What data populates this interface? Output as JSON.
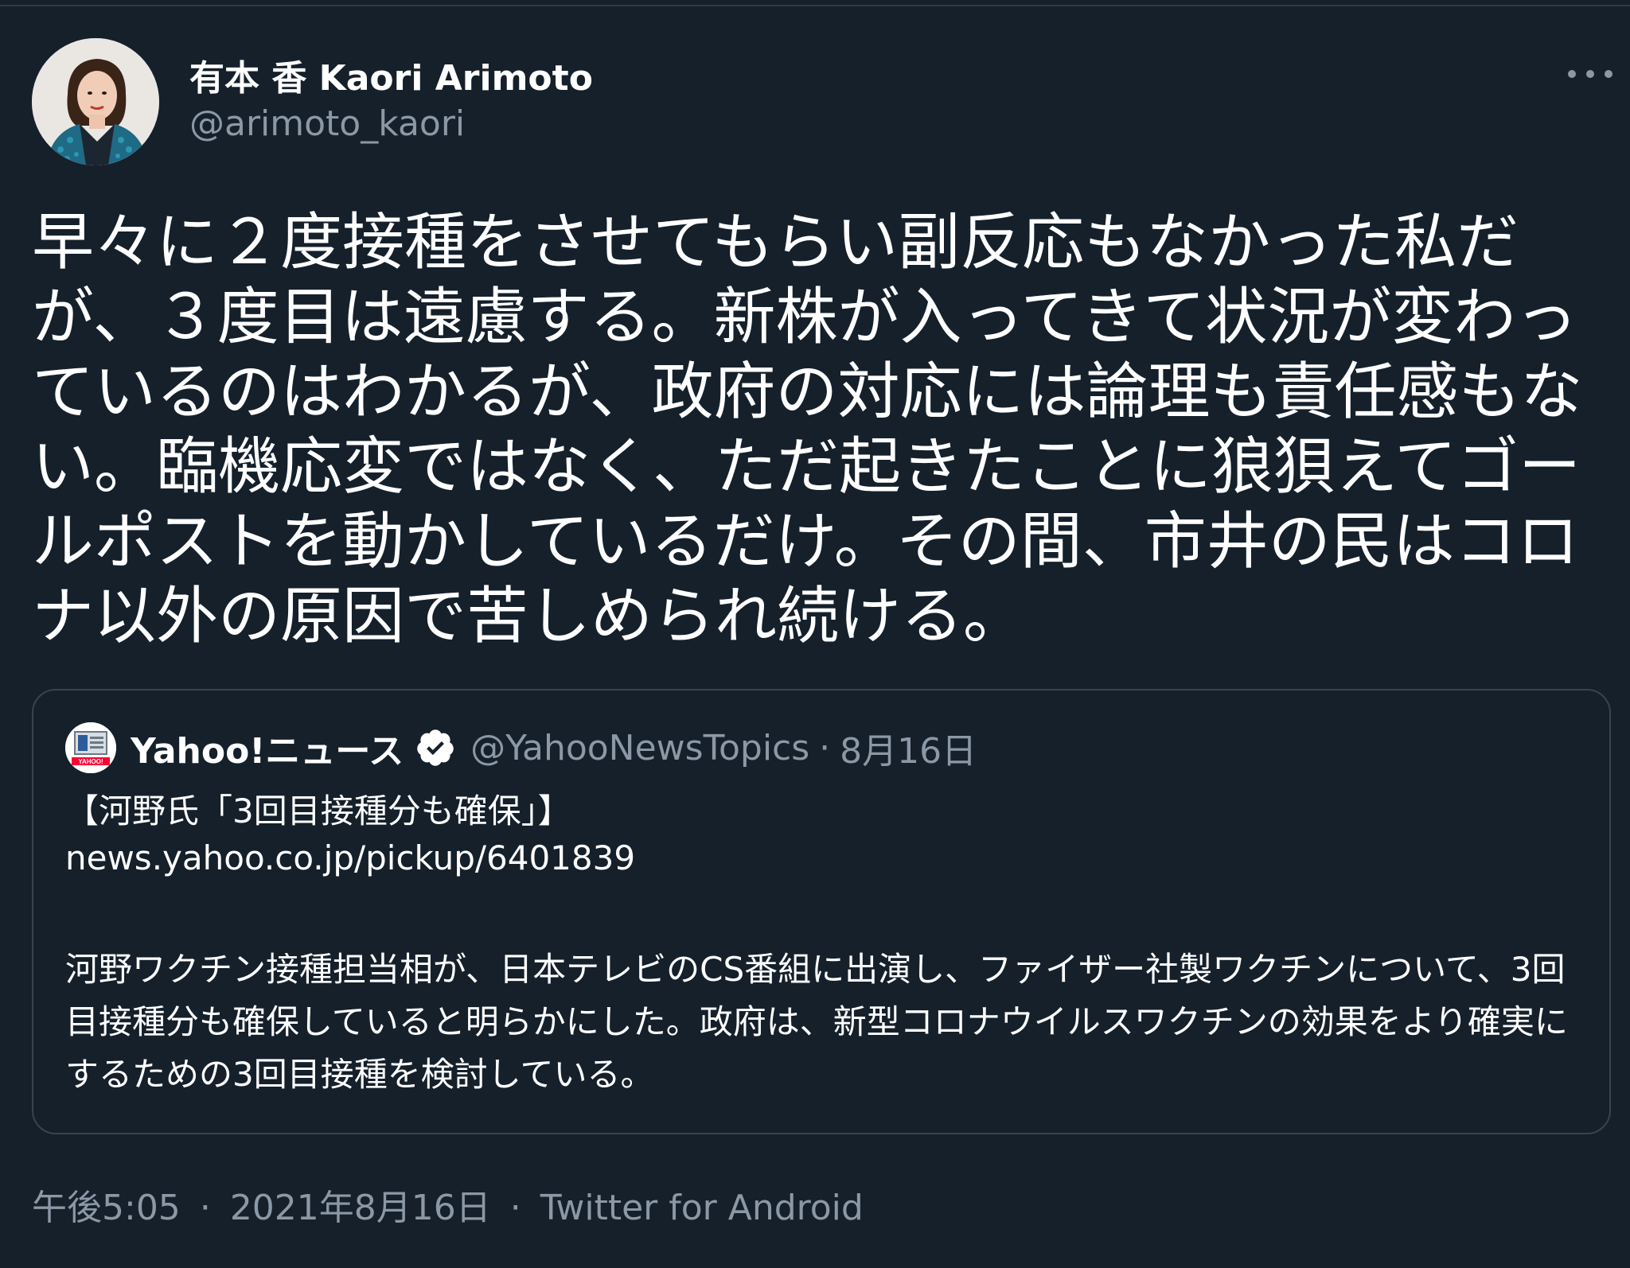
{
  "author": {
    "name": "有本 香 Kaori Arimoto",
    "handle": "@arimoto_kaori"
  },
  "tweet": {
    "text": "早々に２度接種をさせてもらい副反応もなかった私だが、３度目は遠慮する。新株が入ってきて状況が変わっているのはわかるが、政府の対応には論理も責任感もない。臨機応変ではなく、ただ起きたことに狼狽えてゴールポストを動かしているだけ。その間、市井の民はコロナ以外の原因で苦しめられ続ける。"
  },
  "quote": {
    "name": "Yahoo!ニュース",
    "handle": "@YahooNewsTopics",
    "separator": "·",
    "date": "8月16日",
    "title": "【河野氏「3回目接種分も確保」】",
    "link": "news.yahoo.co.jp/pickup/6401839",
    "body": "河野ワクチン接種担当相が、日本テレビのCS番組に出演し、ファイザー社製ワクチンについて、3回目接種分も確保していると明らかにした。政府は、新型コロナウイルスワクチンの効果をより確実にするための3回目接種を検討している。",
    "avatar_label": "YAHOO!"
  },
  "meta": {
    "time": "午後5:05",
    "sep1": "·",
    "date": "2021年8月16日",
    "sep2": "·",
    "source": "Twitter for Android"
  },
  "icons": {
    "more": "more-horizontal-icon",
    "verified": "verified-badge-icon"
  },
  "colors": {
    "background": "#15202b",
    "text": "#ffffff",
    "secondary": "#8b98a5",
    "border": "#38444d"
  }
}
